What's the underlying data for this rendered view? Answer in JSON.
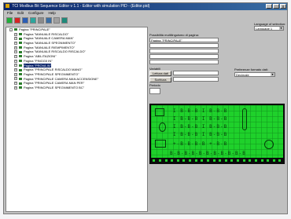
{
  "window": {
    "title": "TCI Modbus Bit Sequence Editor v 1.1 - Editor with simulation PID - (Editor.pid)"
  },
  "menu": [
    "File",
    "Edit",
    "Configure",
    "Help"
  ],
  "toolbar": {
    "tools": [
      "green",
      "red",
      "blue",
      "teal",
      "gray",
      "blue2",
      "gray2",
      "teal2"
    ]
  },
  "language": {
    "label": "Language of selection:",
    "selected": "Language 1"
  },
  "tree": {
    "items": [
      {
        "prefix": "-",
        "text": "Pagina \"PRINCIPALE\"",
        "selected": false
      },
      {
        "prefix": "+",
        "text": "Pagina \"MANUALE RISCALDO\"",
        "selected": false
      },
      {
        "prefix": "+",
        "text": "Pagina \"MANUALE CAMERA MAN\"",
        "selected": false
      },
      {
        "prefix": "+",
        "text": "Pagina \"MANUALE SPEGNIMENTO\"",
        "selected": false
      },
      {
        "prefix": "+",
        "text": "Pagina \"MANUALE RIEMPIMENTO\"",
        "selected": false
      },
      {
        "prefix": "+",
        "text": "Pagina \"MANUALE RISCALDO RISCALDO\"",
        "selected": false
      },
      {
        "prefix": "+",
        "text": "Pagina \"ABILITAZIONI\"",
        "selected": false
      },
      {
        "prefix": "+",
        "text": "Pagina \"PINGGII IN\"",
        "selected": false
      },
      {
        "prefix": "+",
        "text": "Pagina \"PROVA IN\"",
        "selected": true
      },
      {
        "prefix": "+",
        "text": "Pagina \"PRINCIPALE RISCALDO MANO\"",
        "selected": false
      },
      {
        "prefix": "+",
        "text": "Pagina \"PRINCIPALE SPEGNIMENTO\"",
        "selected": false
      },
      {
        "prefix": "+",
        "text": "Pagina \"PRINCIPALE CAMERA MAN ACCENSIONE\"",
        "selected": false
      },
      {
        "prefix": "+",
        "text": "Pagina \"PRINCIPALE CAMERA MAN PER\"",
        "selected": false
      },
      {
        "prefix": "+",
        "text": "Pagina \"PRINCIPALE SPEGNIMENTO BC\"",
        "selected": false
      }
    ]
  },
  "form": {
    "fields_label": "Possibilità multilinguismo di pagina:",
    "fields": [
      "Pagina \"PRINCIPALE\"",
      "",
      "",
      "",
      ""
    ],
    "section_label": "Variabili",
    "button1": "Lettura dati",
    "button2": "Scrittura",
    "dropdown_label": "Preferenze formato dati:",
    "dropdown_value": "Decimale",
    "period_label": "Periodo"
  },
  "lcd": {
    "rows": [
      "I  B-B-B  I  B-B-B",
      "I  B-B-B  I  B-B-B",
      "I  B-B-B  I  B-B-B",
      "I  B-B-B  I  B-B-B",
      "+-B-B-B-B  +-B-B"
    ],
    "bottom_row": "B-B-B-B-B-B-B-B-B-B-B",
    "colors": {
      "background": "#1fd12b",
      "segment": "#063b0a"
    }
  }
}
